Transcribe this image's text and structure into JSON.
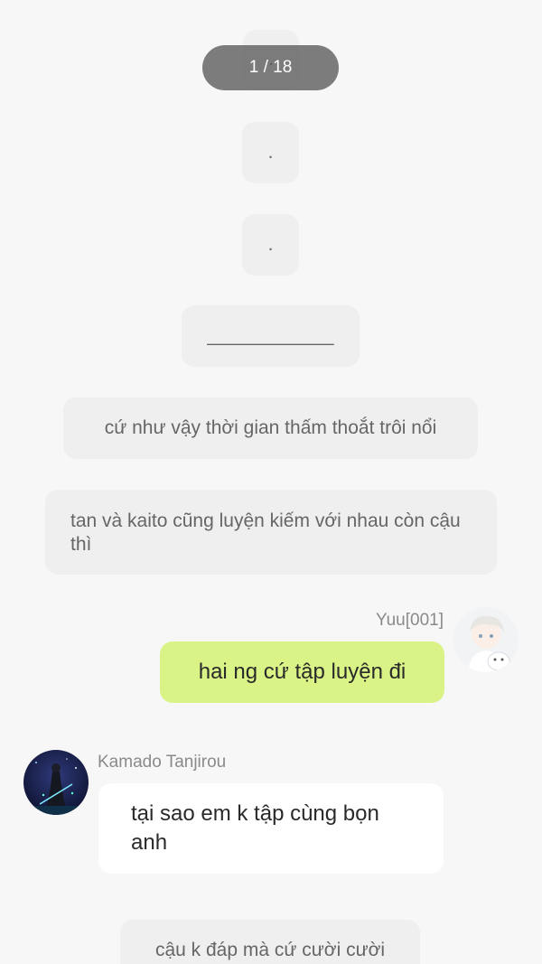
{
  "pager": {
    "label": "1 / 18"
  },
  "narrations": [
    {
      "text": "."
    },
    {
      "text": "."
    },
    {
      "text": "."
    },
    {
      "text": "____________"
    },
    {
      "text": "cứ như vậy thời gian thấm thoắt trôi nổi"
    },
    {
      "text": "tan và kaito cũng luyện kiếm với nhau còn cậu thì"
    },
    {
      "text": "cậu k đáp mà cứ cười cười"
    }
  ],
  "messages": [
    {
      "sender": "Yuu[001]",
      "text": "hai ng cứ tập luyện đi",
      "side": "right",
      "avatar": "anime-boy-avatar"
    },
    {
      "sender": "Kamado Tanjirou",
      "text": "tại sao em k tập cùng bọn anh",
      "side": "left",
      "avatar": "swordsman-avatar"
    }
  ],
  "colors": {
    "background": "#f7f7f7",
    "narration_bubble": "#efefef",
    "right_bubble": "#d9f386",
    "left_bubble": "#ffffff",
    "pager": "#5a5a5a"
  }
}
